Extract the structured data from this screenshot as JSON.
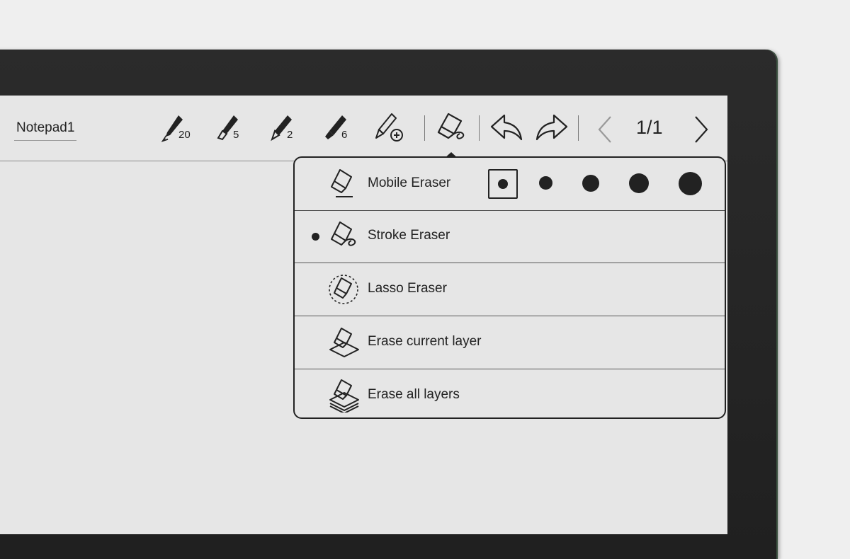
{
  "notebook": {
    "title": "Notepad1"
  },
  "toolbar": {
    "pens": [
      {
        "name": "fountain-pen",
        "size": "20"
      },
      {
        "name": "brush-pen",
        "size": "5"
      },
      {
        "name": "pencil",
        "size": "2"
      },
      {
        "name": "marker",
        "size": "6"
      }
    ],
    "add_pen_icon": "pen-plus-icon",
    "eraser_icon": "eraser-icon",
    "undo_icon": "undo-icon",
    "redo_icon": "redo-icon",
    "page_indicator": "1/1"
  },
  "eraser_menu": {
    "items": [
      {
        "label": "Mobile Eraser",
        "icon": "mobile-eraser-icon",
        "selected": false
      },
      {
        "label": "Stroke Eraser",
        "icon": "stroke-eraser-icon",
        "selected": true
      },
      {
        "label": "Lasso Eraser",
        "icon": "lasso-eraser-icon",
        "selected": false
      },
      {
        "label": "Erase current layer",
        "icon": "erase-layer-icon",
        "selected": false
      },
      {
        "label": "Erase all layers",
        "icon": "erase-all-layers-icon",
        "selected": false
      }
    ],
    "mobile_eraser_sizes": {
      "count": 5,
      "selected_index": 0
    }
  },
  "colors": {
    "ink": "#222222",
    "screen": "#e6e6e6",
    "bezel": "#252525"
  }
}
